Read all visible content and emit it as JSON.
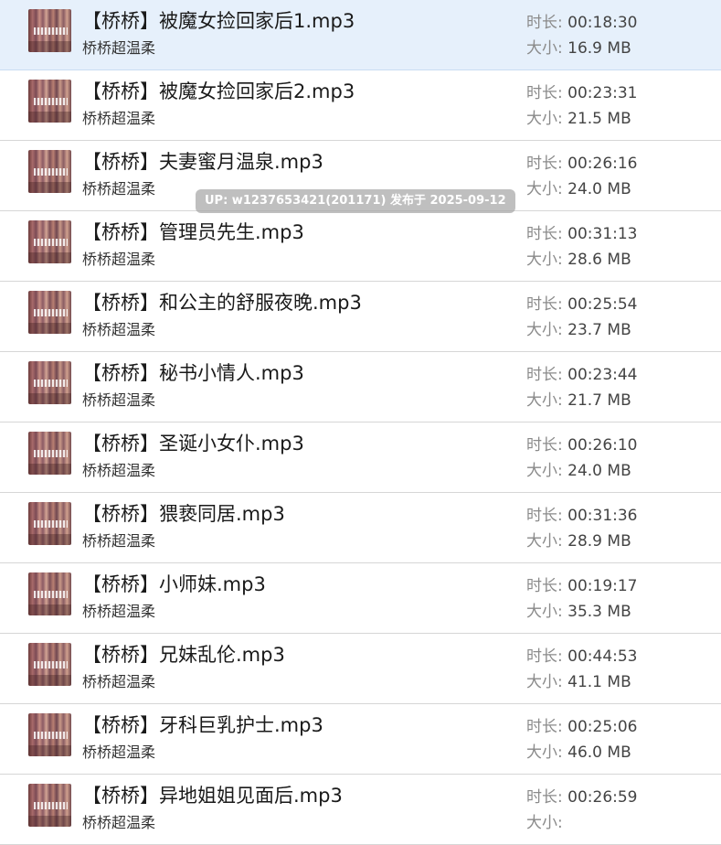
{
  "labels": {
    "duration": "时长: ",
    "size": "大小: "
  },
  "watermark": "UP: w1237653421(201171) 发布于 2025-09-12",
  "tracks": [
    {
      "title": "【桥桥】被魔女捡回家后1.mp3",
      "artist": "桥桥超温柔",
      "duration": "00:18:30",
      "size": "16.9 MB",
      "selected": true
    },
    {
      "title": "【桥桥】被魔女捡回家后2.mp3",
      "artist": "桥桥超温柔",
      "duration": "00:23:31",
      "size": "21.5 MB"
    },
    {
      "title": "【桥桥】夫妻蜜月温泉.mp3",
      "artist": "桥桥超温柔",
      "duration": "00:26:16",
      "size": "24.0 MB"
    },
    {
      "title": "【桥桥】管理员先生.mp3",
      "artist": "桥桥超温柔",
      "duration": "00:31:13",
      "size": "28.6 MB"
    },
    {
      "title": "【桥桥】和公主的舒服夜晚.mp3",
      "artist": "桥桥超温柔",
      "duration": "00:25:54",
      "size": "23.7 MB"
    },
    {
      "title": "【桥桥】秘书小情人.mp3",
      "artist": "桥桥超温柔",
      "duration": "00:23:44",
      "size": "21.7 MB"
    },
    {
      "title": "【桥桥】圣诞小女仆.mp3",
      "artist": "桥桥超温柔",
      "duration": "00:26:10",
      "size": "24.0 MB"
    },
    {
      "title": "【桥桥】猥亵同居.mp3",
      "artist": "桥桥超温柔",
      "duration": "00:31:36",
      "size": "28.9 MB"
    },
    {
      "title": "【桥桥】小师妹.mp3",
      "artist": "桥桥超温柔",
      "duration": "00:19:17",
      "size": "35.3 MB"
    },
    {
      "title": "【桥桥】兄妹乱伦.mp3",
      "artist": "桥桥超温柔",
      "duration": "00:44:53",
      "size": "41.1 MB"
    },
    {
      "title": "【桥桥】牙科巨乳护士.mp3",
      "artist": "桥桥超温柔",
      "duration": "00:25:06",
      "size": "46.0 MB"
    },
    {
      "title": "【桥桥】异地姐姐见面后.mp3",
      "artist": "桥桥超温柔",
      "duration": "00:26:59",
      "size": ""
    }
  ]
}
